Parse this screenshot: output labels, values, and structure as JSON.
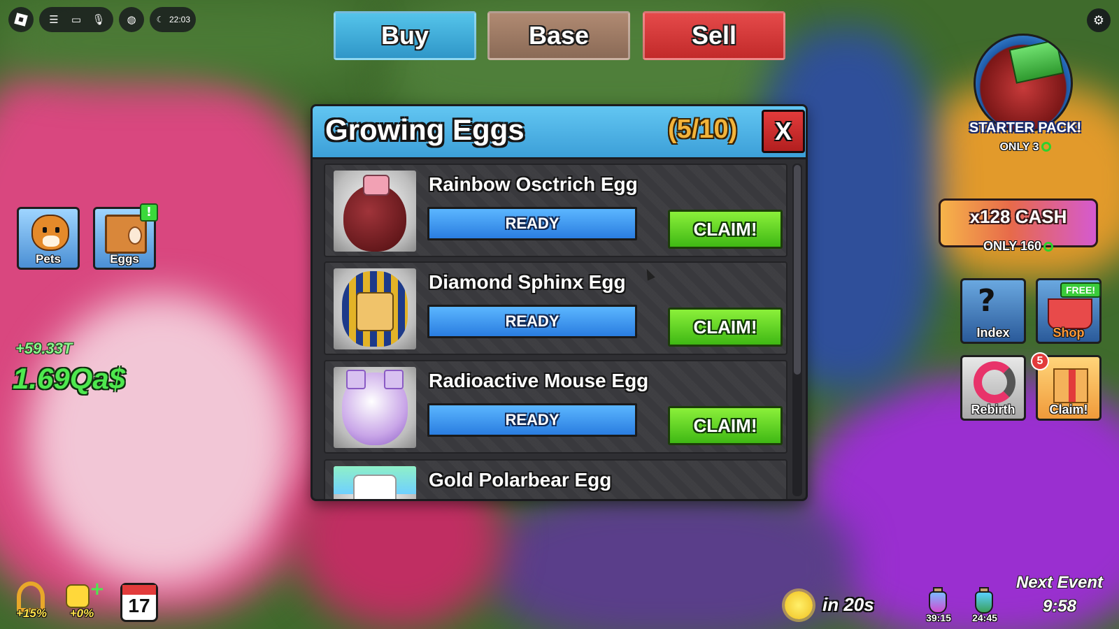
{
  "topbar": {
    "icons": [
      "roblox-icon",
      "menu-icon",
      "chat-icon",
      "mic-icon",
      "backpack-icon"
    ],
    "clock": "22:03"
  },
  "tabs": [
    {
      "label": "Buy",
      "color": "#3fa6d8"
    },
    {
      "label": "Base",
      "color": "#9a7862"
    },
    {
      "label": "Sell",
      "color": "#d43636"
    }
  ],
  "left": {
    "pets_label": "Pets",
    "eggs_label": "Eggs",
    "eggs_alert": "!",
    "income": "+59.33T",
    "money": "1.69Qa$"
  },
  "modal": {
    "title": "Growing Eggs",
    "count": "(5/10)",
    "close_label": "X",
    "eggs": [
      {
        "name": "Rainbow Osctrich Egg",
        "status": "READY",
        "progress": 1.0,
        "claim_label": "CLAIM!"
      },
      {
        "name": "Diamond Sphinx Egg",
        "status": "READY",
        "progress": 1.0,
        "claim_label": "CLAIM!"
      },
      {
        "name": "Radioactive Mouse Egg",
        "status": "READY",
        "progress": 1.0,
        "claim_label": "CLAIM!"
      },
      {
        "name": "Gold Polarbear Egg",
        "status": "",
        "progress": 0,
        "claim_label": ""
      }
    ]
  },
  "right": {
    "starter_title": "STARTER PACK!",
    "starter_price": "ONLY 3",
    "cash_deal": "x128 CASH",
    "cash_price": "ONLY 160",
    "index_label": "Index",
    "shop_label": "Shop",
    "shop_tag": "FREE!",
    "rebirth_label": "Rebirth",
    "claim_label": "Claim!",
    "claim_count": "5"
  },
  "bottom": {
    "boost_pct": "+15%",
    "friend_pct": "+0%",
    "calendar_day": "17",
    "weather_timer": "in 20s",
    "potion1_time": "39:15",
    "potion2_time": "24:45",
    "next_event_label": "Next Event",
    "next_event_time": "9:58"
  },
  "colors": {
    "claim_green": "#3fb814",
    "ready_blue": "#2a7de0",
    "header_blue": "#3c9fd8",
    "count_gold": "#f2b33a",
    "close_red": "#d43636"
  }
}
